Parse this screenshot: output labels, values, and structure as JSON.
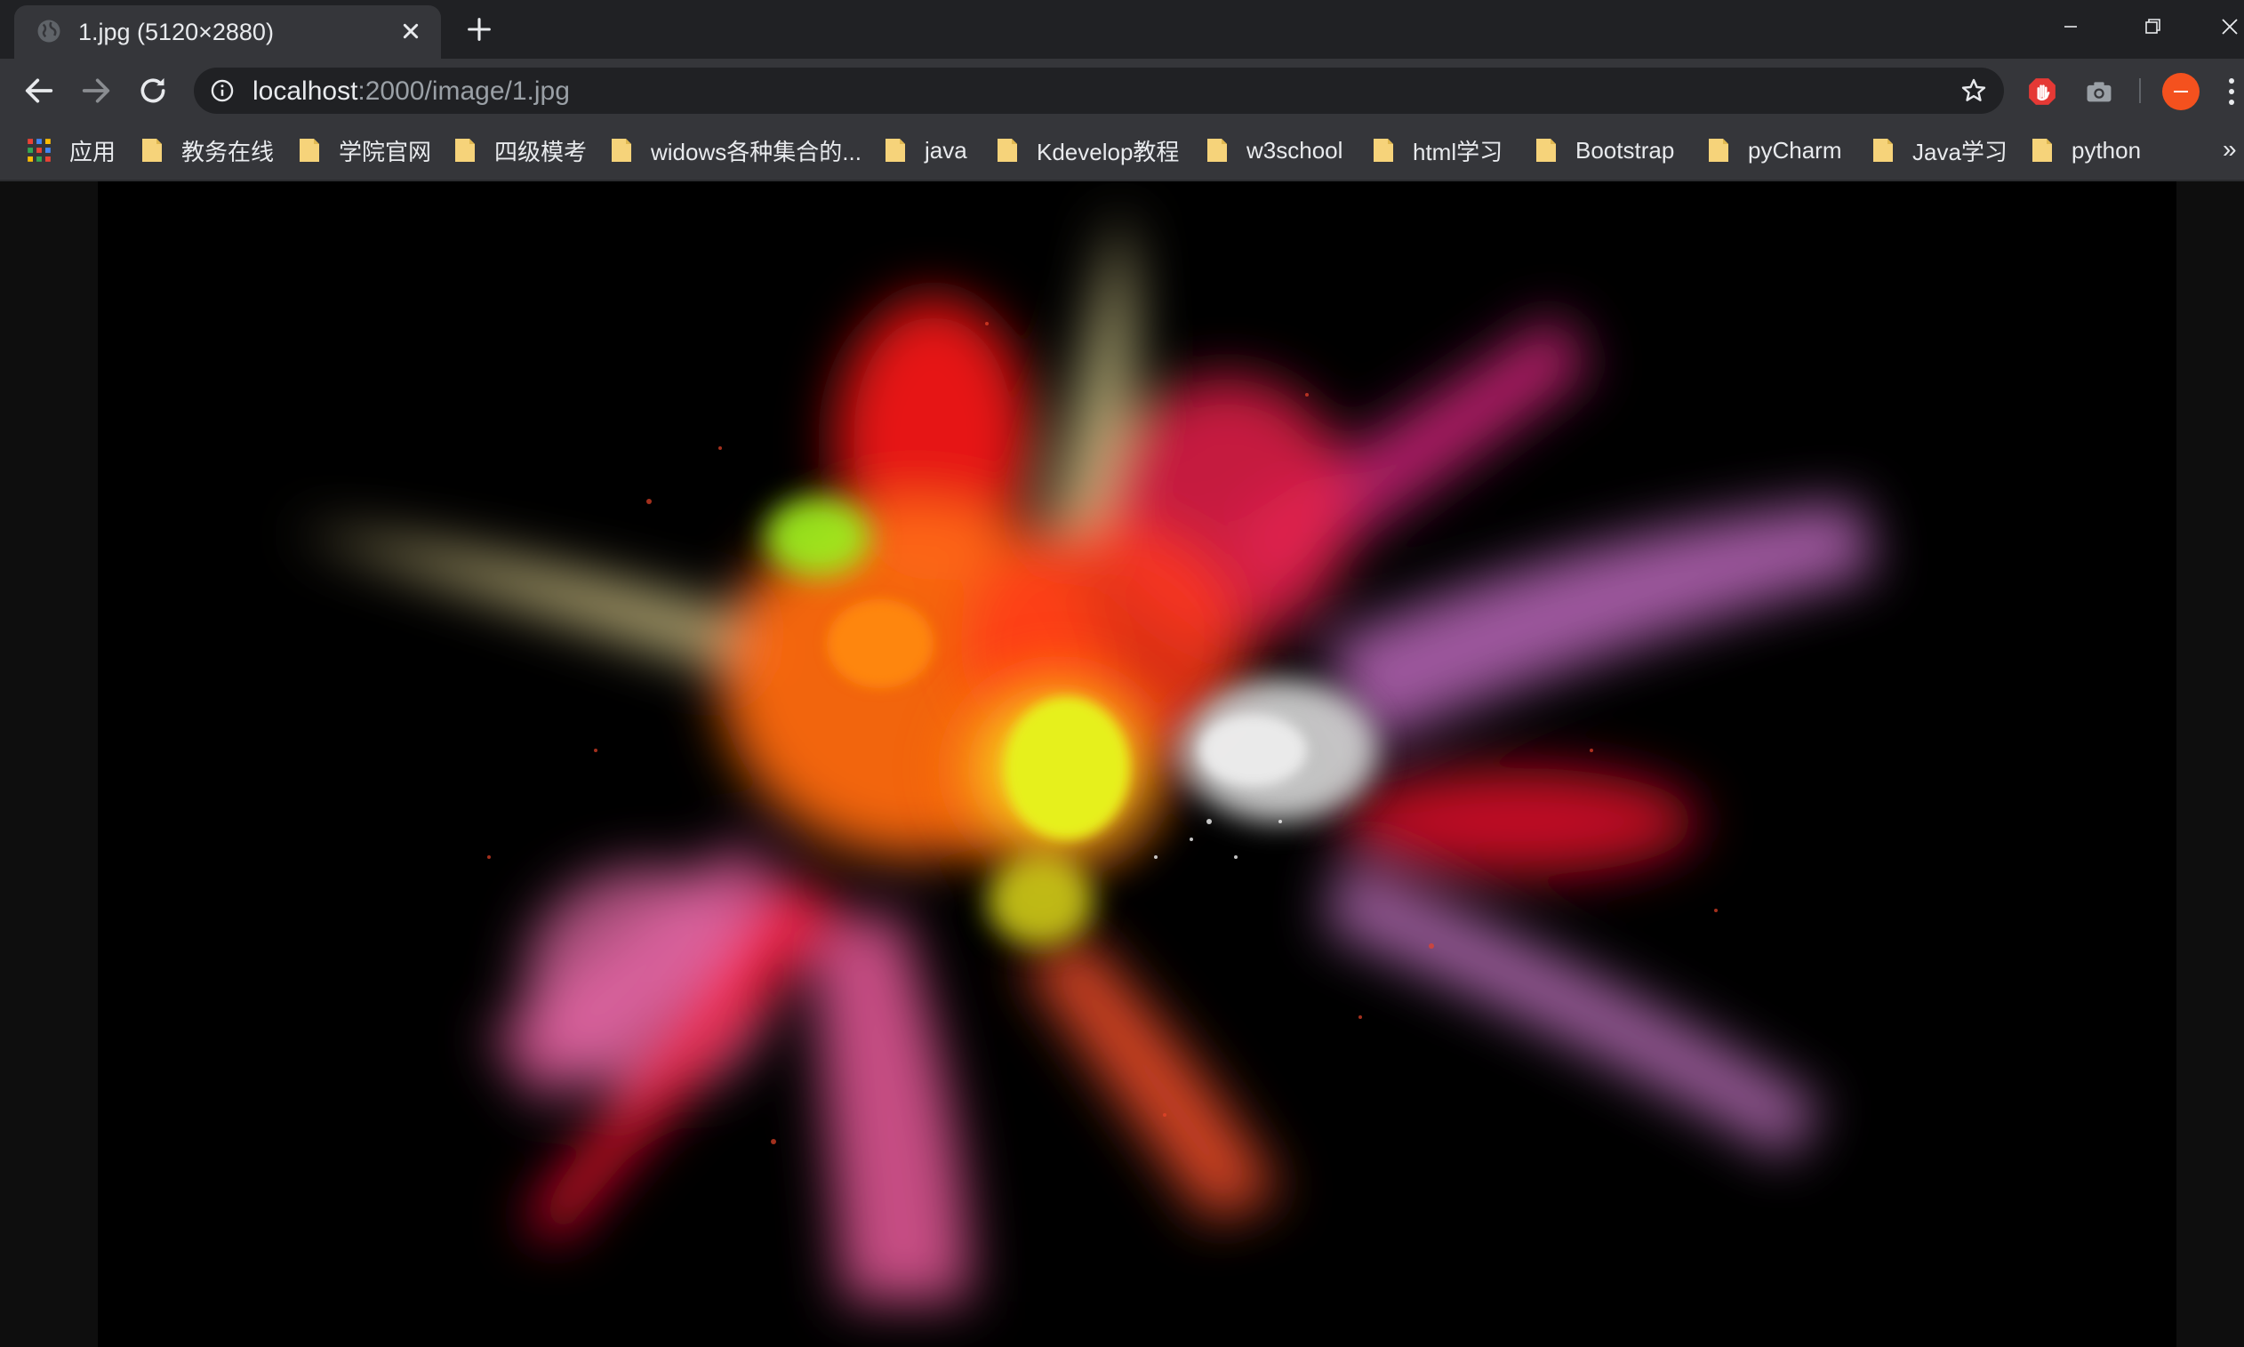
{
  "tab": {
    "title": "1.jpg (5120×2880)"
  },
  "address_bar": {
    "host": "localhost",
    "path": ":2000/image/1.jpg"
  },
  "bookmarks": {
    "apps_label": "应用",
    "items": [
      "教务在线",
      "学院官网",
      "四级模考",
      "widows各种集合的...",
      "java",
      "Kdevelop教程",
      "w3school",
      "html学习",
      "Bootstrap",
      "pyCharm",
      "Java学习",
      "python"
    ],
    "overflow": "»"
  },
  "icons": {
    "tab_favicon": "globe-icon",
    "tab_close": "close-icon",
    "new_tab": "plus-icon",
    "back": "arrow-left-icon",
    "forward": "arrow-right-icon",
    "reload": "reload-icon",
    "site_info": "info-icon",
    "bookmark_star": "star-icon",
    "extension_1": "stop-hand-icon",
    "extension_2": "camera-icon",
    "profile": "avatar",
    "menu": "more-vert-icon",
    "bookmark_folder": "folder-icon",
    "apps": "apps-grid-icon"
  },
  "colors": {
    "frame": "#202124",
    "toolbar": "#35363a",
    "omnibox": "#202124",
    "text": "#e8eaed",
    "muted_text": "#9aa0a6",
    "folder": "#f6d37a",
    "avatar": "#f4511e",
    "extension_red": "#e53935"
  }
}
